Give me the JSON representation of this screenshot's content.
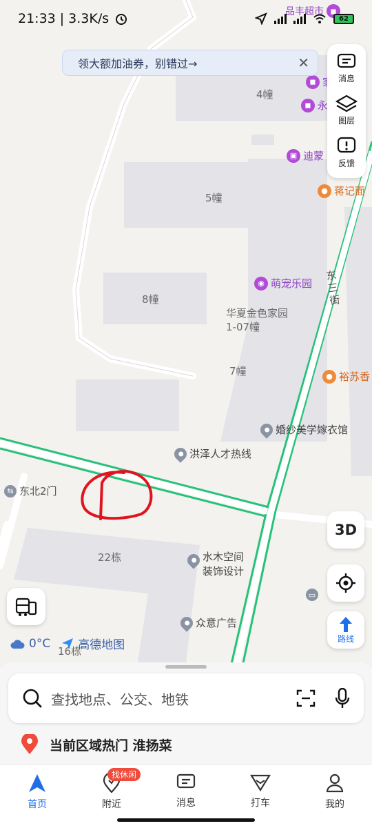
{
  "status": {
    "time": "21:33",
    "speed": "3.3K/s",
    "alarm_icon": "alarm-icon",
    "battery": "62"
  },
  "banner": {
    "text": "领大额加油券，别错过→",
    "close": "✕"
  },
  "toolbar": {
    "messages": "消息",
    "layers": "图层",
    "feedback": "反馈"
  },
  "map": {
    "labels": {
      "b4": "4幢",
      "b5": "5幢",
      "b8": "8幢",
      "b7": "7幢",
      "b22": "22栋",
      "b16": "16栋",
      "street": "东三街",
      "compound": "华夏金色家园1-07幢",
      "gate": "东北2门"
    },
    "pois": {
      "supermarket": "品丰超市",
      "jia": "家",
      "yong": "永",
      "dimeng": "迪蒙",
      "jiangji": "蒋记面",
      "pets": "萌宠乐园",
      "yusu": "裕苏香",
      "wedding": "婚纱美学嫁衣馆",
      "talent": "洪泽人才热线",
      "shuimu": "水木空间装饰设计",
      "zhongyi": "众意广告"
    }
  },
  "controls": {
    "three_d": "3D",
    "route": "路线"
  },
  "weather": {
    "temp": "0°C",
    "logo": "高德地图"
  },
  "search": {
    "placeholder": "查找地点、公交、地铁"
  },
  "hot": {
    "text": "当前区域热门 淮扬菜"
  },
  "nav": {
    "home": "首页",
    "nearby": "附近",
    "nearby_badge": "找休闲",
    "messages": "消息",
    "taxi": "打车",
    "mine": "我的"
  },
  "colors": {
    "accent": "#1f6fe8",
    "road_green": "#27c27a",
    "poi_purple": "#b24bd6",
    "poi_orange": "#ee8b3a",
    "annotation_red": "#e0141e"
  }
}
